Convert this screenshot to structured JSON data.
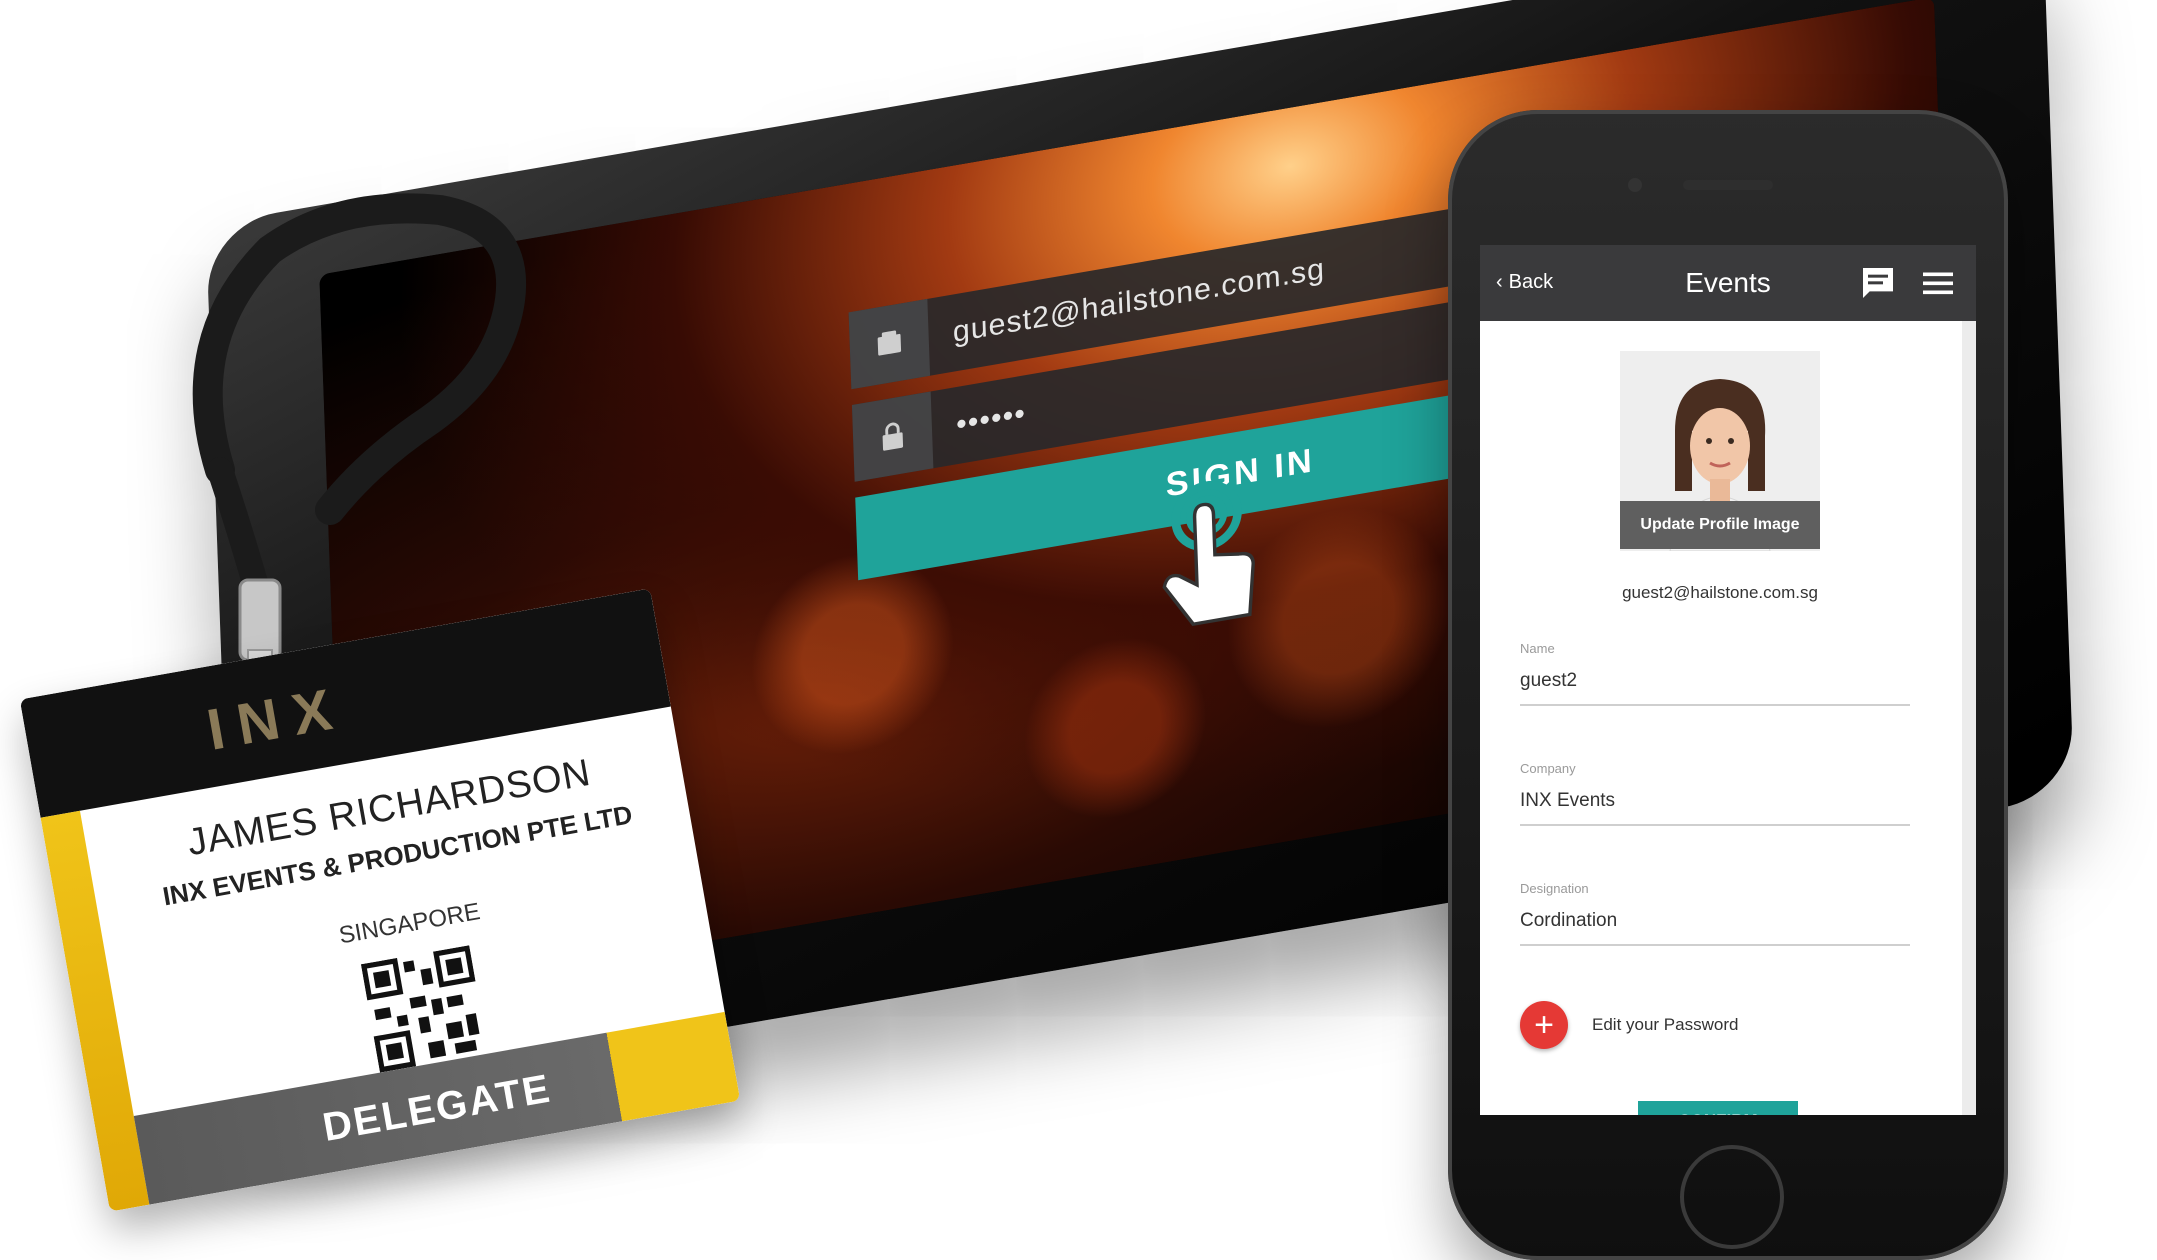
{
  "tablet": {
    "email_value": "guest2@hailstone.com.sg",
    "password_mask": "••••••",
    "signin_label": "SIGN IN"
  },
  "badge": {
    "logo_text": "INX",
    "name": "JAMES RICHARDSON",
    "company": "INX EVENTS & PRODUCTION PTE LTD",
    "city": "SINGAPORE",
    "role": "DELEGATE"
  },
  "phone": {
    "appbar": {
      "back_label": "Back",
      "title": "Events",
      "icons": [
        "chat-icon",
        "menu-icon"
      ]
    },
    "profile": {
      "update_image_label": "Update Profile Image",
      "email": "guest2@hailstone.com.sg"
    },
    "fields": [
      {
        "label": "Name",
        "value": "guest2"
      },
      {
        "label": "Company",
        "value": "INX Events"
      },
      {
        "label": "Designation",
        "value": "Cordination"
      }
    ],
    "edit_password_label": "Edit your Password",
    "confirm_label": "CONFIRM"
  },
  "colors": {
    "accent_teal": "#1fa39a",
    "plus_red": "#e53935",
    "badge_yellow": "#f0c419",
    "appbar_dark": "#3a3a3c"
  }
}
